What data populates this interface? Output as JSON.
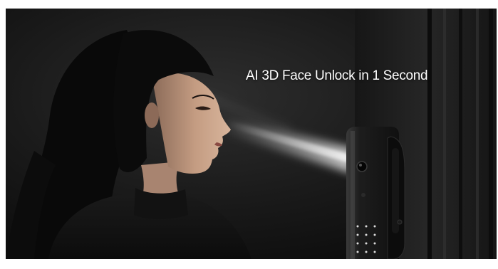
{
  "promo": {
    "caption": "AI 3D Face Unlock in 1 Second"
  },
  "scene": {
    "subject": "woman-profile",
    "device": "smart-lock",
    "effect": "scan-beam"
  },
  "colors": {
    "background": "#141414",
    "hair": "#0a0a0a",
    "skin": "#c9a187",
    "lock_body": "#1e1e1e",
    "beam": "#e8e8e8",
    "caption": "#ffffff"
  }
}
